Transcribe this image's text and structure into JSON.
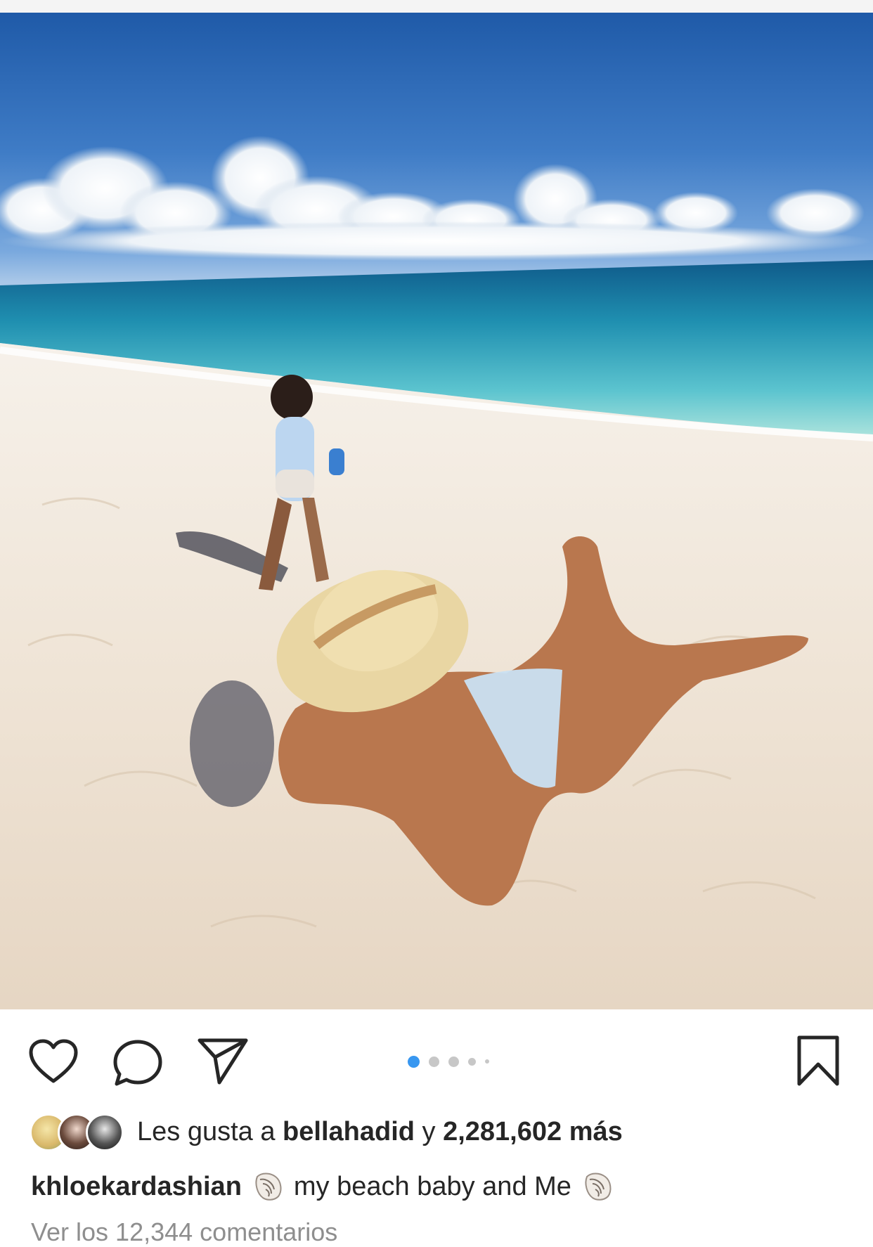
{
  "post": {
    "photo": {
      "description_icon": "beach-photo",
      "carousel_total": 5,
      "carousel_active": 1
    }
  },
  "actions": {
    "like_icon": "heart-icon",
    "comment_icon": "comment-icon",
    "share_icon": "send-icon",
    "save_icon": "bookmark-icon"
  },
  "likes": {
    "prefix": "Les gusta a",
    "user": "bellahadid",
    "connector": "y",
    "count": "2,281,602 más"
  },
  "caption": {
    "username": "khloekardashian",
    "text": "my beach baby and Me",
    "emoji_icon": "shell-icon"
  },
  "comments": {
    "view_all": "Ver los 12,344 comentarios"
  },
  "colors": {
    "accent": "#3897f0",
    "text": "#262626",
    "muted": "#8e8e8e"
  }
}
